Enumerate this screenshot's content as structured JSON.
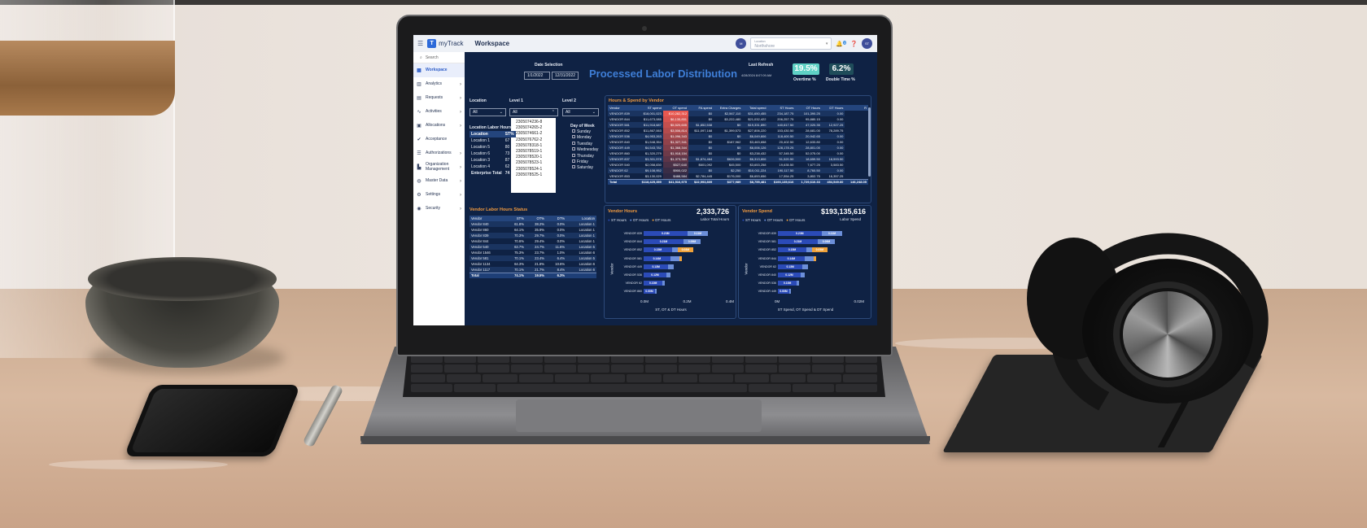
{
  "app": {
    "brand": "myTrack",
    "workspace_title": "Workspace",
    "avatar_left": "M",
    "location_label": "Location",
    "location_value": "Northshore",
    "notif_count": "3",
    "avatar_right": "ST"
  },
  "sidebar": {
    "search": "Search",
    "items": [
      {
        "label": "Workspace",
        "icon": "workspace-icon",
        "active": true,
        "chevron": false
      },
      {
        "label": "Analytics",
        "icon": "chart-icon",
        "chevron": true
      },
      {
        "label": "Requests",
        "icon": "clipboard-icon",
        "chevron": true
      },
      {
        "label": "Activities",
        "icon": "activity-icon",
        "chevron": true
      },
      {
        "label": "Allocations",
        "icon": "allocation-icon",
        "chevron": true
      },
      {
        "label": "Acceptance",
        "icon": "check-circle-icon",
        "chevron": false
      },
      {
        "label": "Authorizations",
        "icon": "sliders-icon",
        "chevron": true
      },
      {
        "label": "Organization Management",
        "icon": "building-icon",
        "chevron": true
      },
      {
        "label": "Master Data",
        "icon": "globe-icon",
        "chevron": true
      },
      {
        "label": "Settings",
        "icon": "gear-icon",
        "chevron": true
      },
      {
        "label": "Security",
        "icon": "user-shield-icon",
        "chevron": true
      }
    ]
  },
  "dashboard": {
    "date_selection_label": "Date Selection",
    "date_from": "1/1/2022",
    "date_to": "12/31/2022",
    "title": "Processed Labor Distribution",
    "last_refresh_label": "Last Refresh",
    "last_refresh_value": "4/28/2024   8:07:09 AM",
    "overtime_pct": "19.5%",
    "overtime_label": "Overtime %",
    "doubletime_pct": "6.2%",
    "doubletime_label": "Double Time %",
    "location_label": "Location",
    "location_value": "All",
    "level1_label": "Level 1",
    "level1_value": "All",
    "level2_label": "Level 2",
    "level2_value": "All",
    "level1_options": [
      "2305074236-8",
      "2305074265-2",
      "2305074661-2",
      "2305076762-2",
      "2305078318-1",
      "2305078519-1",
      "2305078520-1",
      "2305078523-1",
      "2305078524-1",
      "2305078525-1"
    ],
    "day_of_week_label": "Day of Week",
    "days": [
      "Sunday",
      "Monday",
      "Tuesday",
      "Wednesday",
      "Thursday",
      "Friday",
      "Saturday"
    ],
    "location_labor_title": "Location Labor Hours",
    "location_labor_headers": [
      "Location",
      "ST%"
    ],
    "location_labor_rows": [
      [
        "Location 1",
        "67"
      ],
      [
        "Location 5",
        "80"
      ],
      [
        "Location 6",
        "73"
      ],
      [
        "Location 3",
        "87"
      ],
      [
        "Location 4",
        "62"
      ]
    ],
    "location_labor_total": [
      "Enterprise Total",
      "74"
    ],
    "hours_spend_title": "Hours & Spend by Vendor",
    "hours_spend_headers": [
      "Vendor",
      "ST spend",
      "OT spend",
      "FA spend",
      "Extra Charges",
      "Total spend",
      "ST Hours",
      "OT Hours",
      "DT Hours",
      "R"
    ],
    "hours_spend_rows": [
      [
        "VENDOR 839",
        "$18,001,023",
        "$10,282,312",
        "$0",
        "$2,567,110",
        "$31,650,455",
        "234,187.75",
        "101,390.25",
        "0.00"
      ],
      [
        "VENDOR 844",
        "$11,673,085",
        "$6,135,851",
        "$0",
        "$3,222,480",
        "$21,032,422",
        "206,257.75",
        "95,880.15",
        "0.00"
      ],
      [
        "VENDOR 581",
        "$11,918,687",
        "$5,520,605",
        "$1,852,538",
        "$0",
        "$19,331,890",
        "140,617.50",
        "47,020.35",
        "12,927.25"
      ],
      [
        "VENDOR 852",
        "$11,867,063",
        "$3,506,814",
        "$11,097,168",
        "$1,399,573",
        "$27,806,220",
        "153,430.50",
        "28,681.00",
        "78,289.75"
      ],
      [
        "VENDOR 536",
        "$4,953,263",
        "$1,096,343",
        "$0",
        "$0",
        "$6,049,606",
        "118,400.50",
        "20,942.65",
        "0.00"
      ],
      [
        "VENDOR 840",
        "$1,548,354",
        "$1,327,341",
        "$0",
        "$187,962",
        "$3,463,658",
        "20,402.50",
        "12,633.80",
        "0.00"
      ],
      [
        "VENDOR 449",
        "$4,543,782",
        "$1,368,344",
        "$0",
        "$0",
        "$6,006,126",
        "128,178.25",
        "28,801.00",
        "0.00"
      ],
      [
        "VENDOR 860",
        "$1,320,279",
        "$1,918,154",
        "$0",
        "$0",
        "$3,238,432",
        "57,345.50",
        "52,075.00",
        "0.00"
      ],
      [
        "VENDOR 837",
        "$3,301,578",
        "$1,373,384",
        "$1,874,464",
        "$626,500",
        "$6,313,806",
        "51,520.50",
        "18,659.50",
        "18,593.50"
      ],
      [
        "VENDOR 540",
        "$2,058,830",
        "$527,640",
        "$601,092",
        "$45,500",
        "$3,653,258",
        "19,635.50",
        "7,677.25",
        "3,583.50"
      ],
      [
        "VENDOR 62",
        "$9,108,952",
        "$900,022",
        "$0",
        "$2,250",
        "$10,011,224",
        "190,117.50",
        "8,760.50",
        "0.00"
      ],
      [
        "VENDOR 853",
        "$3,130,029",
        "$488,584",
        "$2,784,445",
        "$176,000",
        "$6,653,656",
        "17,554.25",
        "3,802.75",
        "16,357.25"
      ]
    ],
    "hours_spend_total": [
      "Total",
      "$118,425,359",
      "$41,516,975",
      "$22,993,809",
      "$377,989",
      "$8,755,481",
      "$193,135,616",
      "1,729,610.33",
      "454,549.60",
      "146,248.05"
    ],
    "vendor_status_title": "Vendor Labor Hours Status",
    "vendor_status_headers": [
      "Vendor",
      "ST%",
      "OT%",
      "DT%",
      "Location"
    ],
    "vendor_status_rows": [
      [
        "Vendor 840",
        "61.8%",
        "38.2%",
        "0.0%",
        "Location 1"
      ],
      [
        "Vendor 860",
        "64.1%",
        "35.9%",
        "0.0%",
        "Location 1"
      ],
      [
        "Vendor 839",
        "70.3%",
        "29.7%",
        "0.0%",
        "Location 1"
      ],
      [
        "Vendor 844",
        "70.6%",
        "29.4%",
        "0.0%",
        "Location 1"
      ],
      [
        "Vendor 540",
        "63.7%",
        "24.7%",
        "11.6%",
        "Location 5"
      ],
      [
        "Vendor 1546",
        "75.3%",
        "23.7%",
        "1.0%",
        "Location 6"
      ],
      [
        "Vendor 581",
        "70.1%",
        "23.4%",
        "6.4%",
        "Location 5"
      ],
      [
        "Vendor 1134",
        "64.3%",
        "21.8%",
        "10.6%",
        "Location 6"
      ],
      [
        "Vendor 1117",
        "70.1%",
        "21.7%",
        "8.4%",
        "Location 6"
      ]
    ],
    "vendor_status_total": [
      "Total",
      "74.1%",
      "19.5%",
      "6.3%",
      ""
    ],
    "vendor_hours": {
      "title": "Vendor Hours",
      "total": "2,333,726",
      "subtitle": "Labor Total Hours",
      "legend": [
        "ST Hours",
        "OT Hours",
        "DT Hours"
      ],
      "ylabel": "Vendor",
      "xlabel": "ST, OT & DT Hours",
      "ticks": [
        "0.0M",
        "0.2M",
        "0.4M"
      ]
    },
    "vendor_spend": {
      "title": "Vendor Spend",
      "total": "$193,135,616",
      "subtitle": "Labor Spend",
      "legend": [
        "ST Hours",
        "OT Hours",
        "DT Hours"
      ],
      "ylabel": "Vendor",
      "xlabel": "ST Spend, OT Spend & DT Spend",
      "ticks": [
        "0M",
        "0.02M"
      ]
    }
  },
  "chart_data": [
    {
      "type": "bar",
      "orientation": "horizontal",
      "stacked": true,
      "title": "Vendor Hours",
      "categories": [
        "VENDOR 839",
        "VENDOR 844",
        "VENDOR 852",
        "VENDOR 581",
        "VENDOR 449",
        "VENDOR 536",
        "VENDOR 62",
        "VENDOR 860"
      ],
      "series": [
        {
          "name": "ST Hours",
          "color": "#2b4bb8",
          "values": [
            0.23,
            0.21,
            0.15,
            0.14,
            0.13,
            0.12,
            0.1,
            0.06
          ]
        },
        {
          "name": "OT Hours",
          "color": "#6c8fd9",
          "values": [
            0.11,
            0.09,
            0.03,
            0.05,
            0.03,
            0.02,
            0.01,
            0.01
          ]
        },
        {
          "name": "DT Hours",
          "color": "#f0a23a",
          "values": [
            0,
            0,
            0.08,
            0.01,
            0,
            0,
            0,
            0
          ]
        }
      ],
      "labels": [
        [
          "0.23M",
          "0.11M",
          ""
        ],
        [
          "0.21M",
          "0.09M",
          ""
        ],
        [
          "0.15M",
          "",
          "0.08M"
        ],
        [
          "0.14M",
          "",
          ""
        ],
        [
          "0.13M",
          "",
          ""
        ],
        [
          "0.12M",
          "",
          ""
        ],
        [
          "0.10M",
          "",
          ""
        ],
        [
          "0.00M",
          "",
          ""
        ]
      ],
      "xlim": [
        0,
        0.45
      ],
      "xlabel": "ST, OT & DT Hours",
      "ylabel": "Vendor"
    },
    {
      "type": "bar",
      "orientation": "horizontal",
      "stacked": true,
      "title": "Vendor Spend",
      "categories": [
        "VENDOR 839",
        "VENDOR 581",
        "VENDOR 852",
        "VENDOR 844",
        "VENDOR 62",
        "VENDOR 840",
        "VENDOR 536",
        "VENDOR 449"
      ],
      "series": [
        {
          "name": "ST Hours",
          "color": "#2b4bb8",
          "values": [
            0.23,
            0.21,
            0.15,
            0.14,
            0.13,
            0.12,
            0.1,
            0.06
          ]
        },
        {
          "name": "OT Hours",
          "color": "#6c8fd9",
          "values": [
            0.11,
            0.09,
            0.03,
            0.05,
            0.03,
            0.02,
            0.01,
            0.01
          ]
        },
        {
          "name": "DT Hours",
          "color": "#f0a23a",
          "values": [
            0,
            0,
            0.08,
            0.01,
            0,
            0,
            0,
            0
          ]
        }
      ],
      "labels": [
        [
          "0.23M",
          "0.11M",
          ""
        ],
        [
          "0.21M",
          "0.09M",
          ""
        ],
        [
          "0.15M",
          "",
          "0.05M"
        ],
        [
          "0.14M",
          "",
          ""
        ],
        [
          "0.13M",
          "",
          ""
        ],
        [
          "0.12M",
          "",
          ""
        ],
        [
          "0.10M",
          "",
          ""
        ],
        [
          "0.00M",
          "",
          ""
        ]
      ],
      "xlim": [
        0,
        0.45
      ],
      "xlabel": "ST Spend, OT Spend & DT Spend",
      "ylabel": "Vendor"
    }
  ]
}
